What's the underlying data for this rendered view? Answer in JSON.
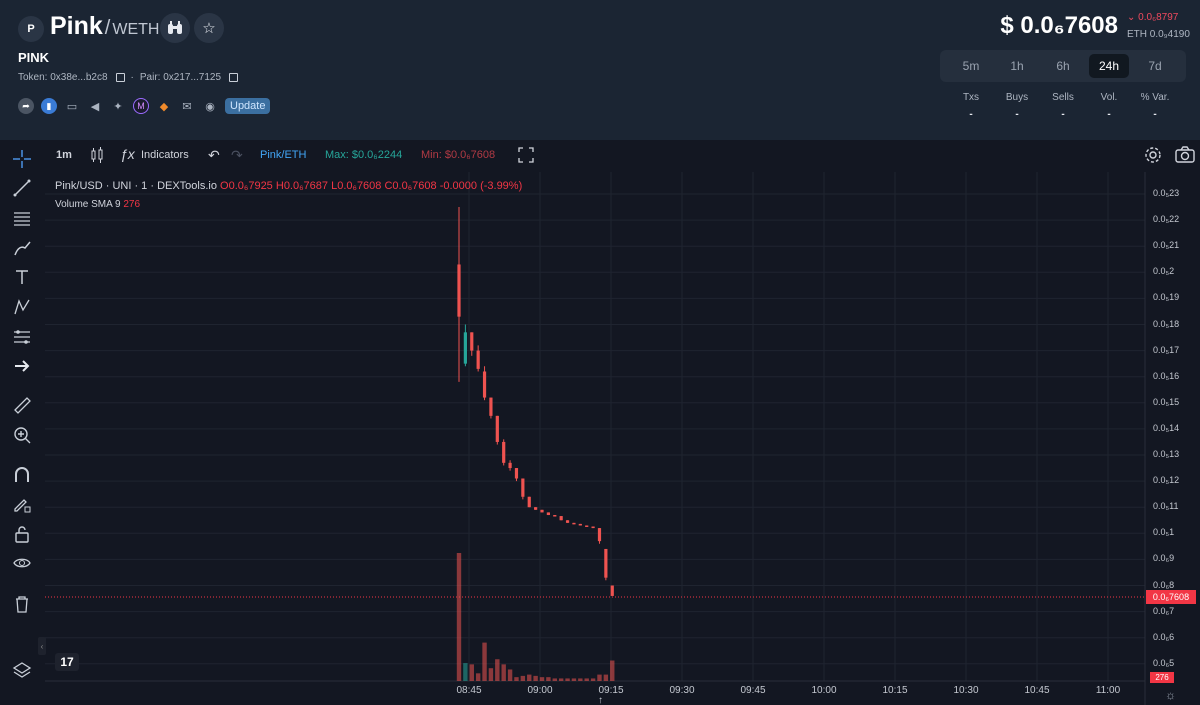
{
  "header": {
    "logo_letter": "P",
    "base": "Pink",
    "separator": "/",
    "quote": "WETH",
    "symbol": "PINK",
    "token_label": "Token: 0x38e...b2c8",
    "pair_label": "Pair: 0x217...7125",
    "update_label": "Update",
    "price": "$ 0.0₆7608",
    "change": "0.0₆8797",
    "eth_price": "ETH 0.0₉4190",
    "timeframes": [
      "5m",
      "1h",
      "6h",
      "24h",
      "7d"
    ],
    "active_timeframe": "24h",
    "stats": [
      {
        "label": "Txs",
        "value": "-"
      },
      {
        "label": "Buys",
        "value": "-"
      },
      {
        "label": "Sells",
        "value": "-"
      },
      {
        "label": "Vol.",
        "value": "-"
      },
      {
        "label": "% Var.",
        "value": "-"
      }
    ],
    "colors": {
      "down": "#f04a5e",
      "accent": "#3b6fa0"
    }
  },
  "toolbar": {
    "interval": "1m",
    "indicators": "Indicators",
    "pair": "Pink/ETH",
    "max_label": "Max: $0.0₆2244",
    "min_label": "Min: $0.0₆7608"
  },
  "legend": {
    "title": "Pink/USD · UNI · 1 · DEXTools.io",
    "o": "O0.0₆7925",
    "h": "H0.0₆7687",
    "l": "L0.0₆7608",
    "c": "C0.0₆7608",
    "chg": "-0.0000 (-3.99%)",
    "volume_label": "Volume SMA 9",
    "volume_value": "276"
  },
  "chart_data": {
    "type": "candlestick",
    "y_ticks": [
      "0.0₅23",
      "0.0₅22",
      "0.0₅21",
      "0.0₅2",
      "0.0₅19",
      "0.0₅18",
      "0.0₅17",
      "0.0₅16",
      "0.0₅15",
      "0.0₅14",
      "0.0₅13",
      "0.0₅12",
      "0.0₅11",
      "0.0₅1",
      "0.0₆9",
      "0.0₆8",
      "0.0₆7",
      "0.0₆6",
      "0.0₆5"
    ],
    "x_ticks": [
      "08:45",
      "09:00",
      "09:15",
      "09:30",
      "09:45",
      "10:00",
      "10:15",
      "10:30",
      "10:45",
      "11:00"
    ],
    "last_price_label": "0.0₆7608",
    "volume_last_label": "276",
    "candles": [
      {
        "o": 2.03,
        "h": 2.25,
        "l": 1.58,
        "c": 1.83,
        "dir": "down"
      },
      {
        "o": 1.65,
        "h": 1.8,
        "l": 1.64,
        "c": 1.77,
        "dir": "up"
      },
      {
        "o": 1.77,
        "h": 1.77,
        "l": 1.68,
        "c": 1.7,
        "dir": "down"
      },
      {
        "o": 1.7,
        "h": 1.72,
        "l": 1.62,
        "c": 1.63,
        "dir": "down"
      },
      {
        "o": 1.62,
        "h": 1.64,
        "l": 1.51,
        "c": 1.52,
        "dir": "down"
      },
      {
        "o": 1.52,
        "h": 1.52,
        "l": 1.44,
        "c": 1.45,
        "dir": "down"
      },
      {
        "o": 1.45,
        "h": 1.45,
        "l": 1.34,
        "c": 1.35,
        "dir": "down"
      },
      {
        "o": 1.35,
        "h": 1.36,
        "l": 1.26,
        "c": 1.27,
        "dir": "down"
      },
      {
        "o": 1.27,
        "h": 1.28,
        "l": 1.24,
        "c": 1.25,
        "dir": "down"
      },
      {
        "o": 1.25,
        "h": 1.25,
        "l": 1.2,
        "c": 1.21,
        "dir": "down"
      },
      {
        "o": 1.21,
        "h": 1.21,
        "l": 1.13,
        "c": 1.14,
        "dir": "down"
      },
      {
        "o": 1.14,
        "h": 1.14,
        "l": 1.1,
        "c": 1.1,
        "dir": "down"
      },
      {
        "o": 1.1,
        "h": 1.1,
        "l": 1.09,
        "c": 1.09,
        "dir": "down"
      },
      {
        "o": 1.09,
        "h": 1.09,
        "l": 1.08,
        "c": 1.08,
        "dir": "down"
      },
      {
        "o": 1.08,
        "h": 1.08,
        "l": 1.07,
        "c": 1.07,
        "dir": "down"
      },
      {
        "o": 1.07,
        "h": 1.07,
        "l": 1.065,
        "c": 1.066,
        "dir": "down"
      },
      {
        "o": 1.066,
        "h": 1.066,
        "l": 1.05,
        "c": 1.05,
        "dir": "down"
      },
      {
        "o": 1.05,
        "h": 1.05,
        "l": 1.04,
        "c": 1.04,
        "dir": "down"
      },
      {
        "o": 1.04,
        "h": 1.04,
        "l": 1.035,
        "c": 1.036,
        "dir": "down"
      },
      {
        "o": 1.036,
        "h": 1.036,
        "l": 1.03,
        "c": 1.03,
        "dir": "down"
      },
      {
        "o": 1.03,
        "h": 1.03,
        "l": 1.025,
        "c": 1.026,
        "dir": "down"
      },
      {
        "o": 1.026,
        "h": 1.026,
        "l": 1.02,
        "c": 1.02,
        "dir": "down"
      },
      {
        "o": 1.02,
        "h": 1.02,
        "l": 0.96,
        "c": 0.97,
        "dir": "down"
      },
      {
        "o": 0.94,
        "h": 0.94,
        "l": 0.82,
        "c": 0.83,
        "dir": "down"
      },
      {
        "o": 0.8,
        "h": 0.8,
        "l": 0.76,
        "c": 0.76,
        "dir": "down"
      }
    ],
    "volumes": [
      {
        "v": 100,
        "dir": "down"
      },
      {
        "v": 14,
        "dir": "up"
      },
      {
        "v": 13,
        "dir": "down"
      },
      {
        "v": 6,
        "dir": "down"
      },
      {
        "v": 30,
        "dir": "down"
      },
      {
        "v": 10,
        "dir": "down"
      },
      {
        "v": 17,
        "dir": "down"
      },
      {
        "v": 13,
        "dir": "down"
      },
      {
        "v": 9,
        "dir": "down"
      },
      {
        "v": 3,
        "dir": "down"
      },
      {
        "v": 4,
        "dir": "down"
      },
      {
        "v": 5,
        "dir": "down"
      },
      {
        "v": 4,
        "dir": "down"
      },
      {
        "v": 3,
        "dir": "down"
      },
      {
        "v": 3,
        "dir": "down"
      },
      {
        "v": 2,
        "dir": "down"
      },
      {
        "v": 2,
        "dir": "down"
      },
      {
        "v": 2,
        "dir": "down"
      },
      {
        "v": 2,
        "dir": "down"
      },
      {
        "v": 2,
        "dir": "down"
      },
      {
        "v": 2,
        "dir": "down"
      },
      {
        "v": 2,
        "dir": "down"
      },
      {
        "v": 5,
        "dir": "down"
      },
      {
        "v": 5,
        "dir": "down"
      },
      {
        "v": 16,
        "dir": "down"
      }
    ],
    "colors": {
      "up": "#26a69a",
      "down": "#ef5350",
      "grid": "#1f2430"
    }
  }
}
